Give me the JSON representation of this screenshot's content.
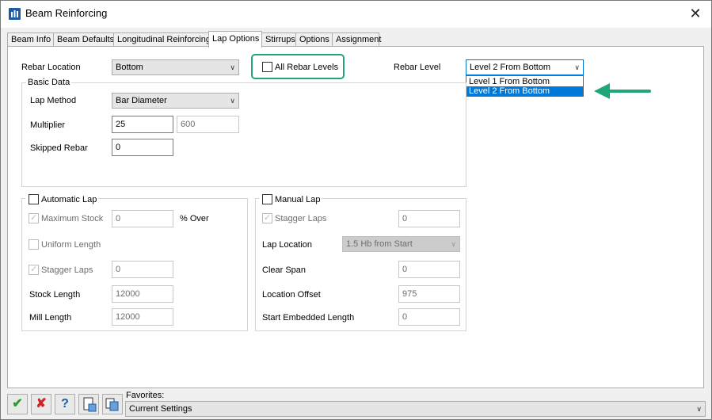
{
  "window": {
    "title": "Beam Reinforcing",
    "close_glyph": "✕"
  },
  "tabs": [
    {
      "label": "Beam Info"
    },
    {
      "label": "Beam Defaults"
    },
    {
      "label": "Longitudinal Reinforcing"
    },
    {
      "label": "Lap Options",
      "active": true
    },
    {
      "label": "Stirrups"
    },
    {
      "label": "Options"
    },
    {
      "label": "Assignment"
    }
  ],
  "top_row": {
    "rebar_location_label": "Rebar Location",
    "rebar_location_value": "Bottom",
    "all_rebar_levels_label": "All Rebar Levels",
    "rebar_level_label": "Rebar Level",
    "rebar_level_value": "Level 2 From Bottom"
  },
  "rebar_level_options": [
    "Level 1 From Bottom",
    "Level 2 From Bottom"
  ],
  "basic_data": {
    "legend": "Basic Data",
    "lap_method_label": "Lap Method",
    "lap_method_value": "Bar Diameter",
    "multiplier_label": "Multiplier",
    "multiplier_value": "25",
    "multiplier_length": "600",
    "skipped_rebar_label": "Skipped Rebar",
    "skipped_rebar_value": "0"
  },
  "automatic_lap": {
    "title": "Automatic Lap",
    "maximum_stock_label": "Maximum Stock",
    "maximum_stock_value": "0",
    "percent_over_label": "% Over",
    "uniform_length_label": "Uniform Length",
    "stagger_laps_label": "Stagger Laps",
    "stagger_laps_value": "0",
    "stock_length_label": "Stock Length",
    "stock_length_value": "12000",
    "mill_length_label": "Mill Length",
    "mill_length_value": "12000"
  },
  "manual_lap": {
    "title": "Manual Lap",
    "stagger_laps_label": "Stagger Laps",
    "stagger_laps_value": "0",
    "lap_location_label": "Lap Location",
    "lap_location_value": "1.5 Hb from Start",
    "clear_span_label": "Clear Span",
    "clear_span_value": "0",
    "location_offset_label": "Location Offset",
    "location_offset_value": "975",
    "start_embedded_label": "Start Embedded Length",
    "start_embedded_value": "0"
  },
  "footer": {
    "favorites_label": "Favorites:",
    "favorites_value": "Current Settings"
  },
  "colors": {
    "highlight": "#1fa67a",
    "selection": "#0078d7"
  }
}
